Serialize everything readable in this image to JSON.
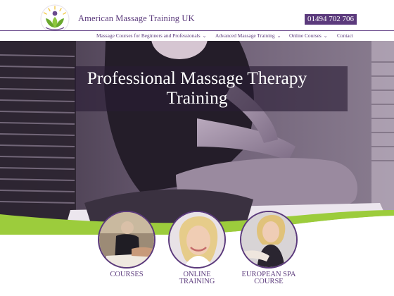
{
  "header": {
    "brand": "American Massage Training UK",
    "phone": "01494 702 706"
  },
  "nav": {
    "items": [
      {
        "label": "Massage Courses for Beginners and Professionals",
        "dropdown": true
      },
      {
        "label": "Advanced Massage Training",
        "dropdown": true
      },
      {
        "label": "Online Courses",
        "dropdown": true
      },
      {
        "label": "Contact",
        "dropdown": false
      }
    ],
    "chevron": "⌄"
  },
  "hero": {
    "title_line1": "Professional Massage Therapy",
    "title_line2": "Training"
  },
  "cards": [
    {
      "line1": "COURSES",
      "line2": ""
    },
    {
      "line1": "ONLINE",
      "line2": "TRAINING"
    },
    {
      "line1": "EUROPEAN SPA",
      "line2": "COURSE"
    }
  ],
  "colors": {
    "brand_purple": "#5b3a7c",
    "accent_green": "#9ccc3c",
    "hero_tint": "#5e4d66"
  }
}
